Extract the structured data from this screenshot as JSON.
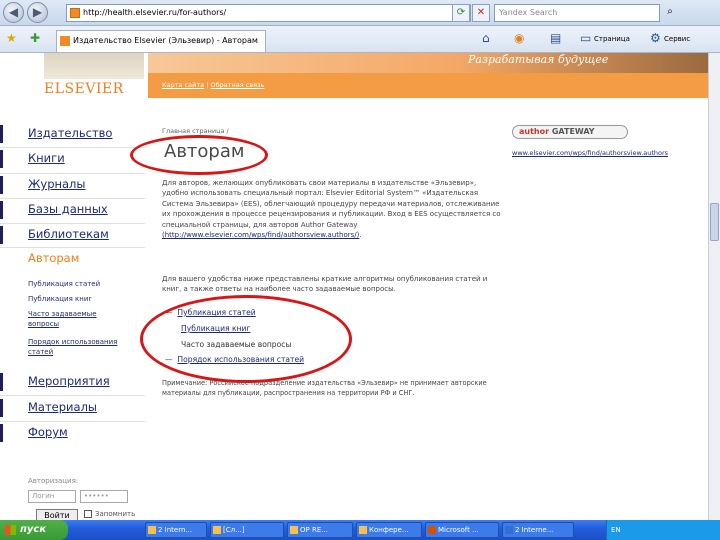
{
  "browser": {
    "url": "http://health.elsevier.ru/for-authors/",
    "search_placeholder": "Yandex Search",
    "tab_title": "Издательство Elsevier (Эльзевир) - Авторам",
    "toolbar_page": "Страница",
    "toolbar_service": "Сервис"
  },
  "site": {
    "logo": "ELSEVIER",
    "slogan": "Разрабатывая будущее",
    "top_links": [
      "Карта сайта",
      "Обратная связь"
    ]
  },
  "sidebar": {
    "items": [
      {
        "label": "Издательство"
      },
      {
        "label": "Книги"
      },
      {
        "label": "Журналы"
      },
      {
        "label": "Базы данных"
      },
      {
        "label": "Библиотекам"
      },
      {
        "label": "Авторам"
      },
      {
        "label": "Мероприятия"
      },
      {
        "label": "Материалы"
      },
      {
        "label": "Форум"
      }
    ],
    "subitems": [
      "Публикация статей",
      "Публикация книг",
      "Часто задаваемые",
      "вопросы",
      "Порядок использования",
      "статей"
    ],
    "login_label": "Авторизация:",
    "login_placeholder": "Логин",
    "password_mask": "••••••",
    "login_button": "Войти",
    "remember": "Запомнить"
  },
  "main": {
    "breadcrumb": "Главная страница /",
    "title": "Авторам",
    "intro": "Для авторов, желающих опубликовать свои материалы в издательстве «Эльзевир», удобно использовать специальный портал: Elsevier Editorial System™ «Издательская Система Эльзевира» (EES), облегчающий процедуру передачи материалов, отслеживание их прохождения в процессе рецензирования и публикации. Вход в EES осуществляется со специальной страницы, для авторов Author Gateway",
    "intro_link": "(http://www.elsevier.com/wps/find/authorsview.authors/)",
    "intro_end": ".",
    "faq_intro": "Для вашего удобства ниже представлены краткие алгоритмы опубликования статей и книг, а также ответы на наиболее часто задаваемые вопросы.",
    "faq": [
      {
        "label": "Публикация статей"
      },
      {
        "label": "Публикация книг"
      },
      {
        "label": "Часто задаваемые вопросы"
      },
      {
        "label": "Порядок использования статей"
      }
    ],
    "note": "Примечание: Российское подразделение издательства «Эльзевир» не принимает авторские материалы для публикации, распространения на территории РФ и СНГ."
  },
  "gateway": {
    "badge": "author",
    "badge_gateway": "GATEWAY",
    "link": "www.elsevier.com/wps/find/authorsview.authors"
  },
  "taskbar": {
    "start": "пуск",
    "tasks": [
      "2 Intern...",
      "[Сл...]",
      "OP RE...",
      "Конфере...",
      "Microsoft ...",
      "2 Interne..."
    ],
    "lang": "EN"
  },
  "colors": {
    "accent": "#f39c43",
    "link": "#1c2a7a",
    "highlight_ring": "#d91616"
  }
}
